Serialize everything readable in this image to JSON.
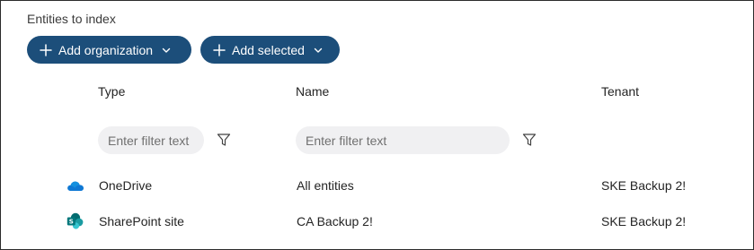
{
  "section": {
    "title": "Entities to index"
  },
  "toolbar": {
    "add_organization_label": "Add organization",
    "add_selected_label": "Add selected"
  },
  "columns": {
    "type": "Type",
    "name": "Name",
    "tenant": "Tenant"
  },
  "filters": {
    "type_placeholder": "Enter filter text",
    "name_placeholder": "Enter filter text"
  },
  "rows": [
    {
      "icon": "onedrive-icon",
      "type": "OneDrive",
      "name": "All entities",
      "tenant": "SKE Backup 2!"
    },
    {
      "icon": "sharepoint-icon",
      "type": "SharePoint site",
      "name": "CA Backup 2!",
      "tenant": "SKE Backup 2!"
    }
  ],
  "colors": {
    "button_bg": "#1c4e7a",
    "filter_bg": "#f0f0f2",
    "onedrive_blue": "#0f78d4",
    "sharepoint_teal": "#03787c"
  }
}
